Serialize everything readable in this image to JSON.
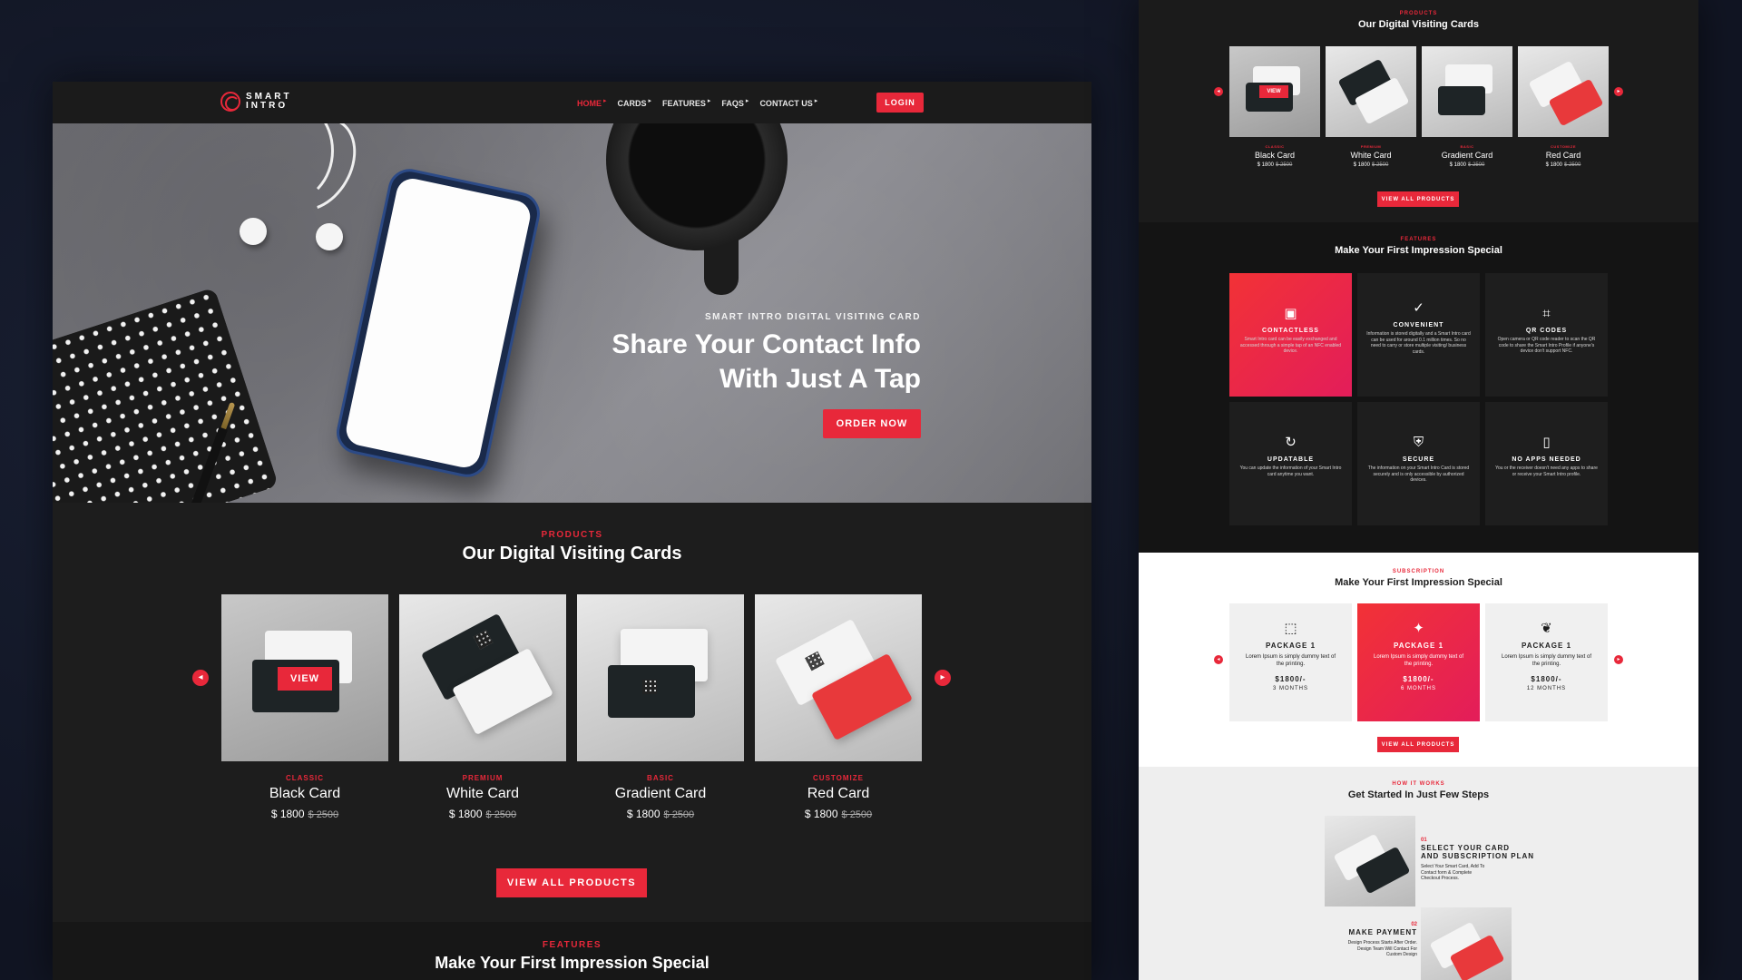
{
  "colors": {
    "accent": "#e8283a",
    "dark_bg": "#1d1d1d",
    "page_bg": "#151a2a"
  },
  "nav": {
    "logo_line1": "SMART",
    "logo_line2": "INTRO",
    "items": [
      "HOME",
      "CARDS",
      "FEATURES",
      "FAQS",
      "CONTACT US"
    ],
    "active": "HOME",
    "login": "LOGIN"
  },
  "hero": {
    "eyebrow": "SMART INTRO DIGITAL VISITING CARD",
    "headline_1": "Share Your Contact Info",
    "headline_2": "With Just A Tap",
    "cta": "ORDER NOW"
  },
  "products": {
    "label": "PRODUCTS",
    "title": "Our Digital Visiting Cards",
    "view_label": "VIEW",
    "prev_icon": "chevron-left-icon",
    "next_icon": "chevron-right-icon",
    "cards": [
      {
        "tag": "CLASSIC",
        "name": "Black Card",
        "price": "$ 1800",
        "old_price": "$ 2500"
      },
      {
        "tag": "PREMIUM",
        "name": "White Card",
        "price": "$ 1800",
        "old_price": "$ 2500"
      },
      {
        "tag": "BASIC",
        "name": "Gradient Card",
        "price": "$ 1800",
        "old_price": "$ 2500"
      },
      {
        "tag": "CUSTOMIZE",
        "name": "Red Card",
        "price": "$ 1800",
        "old_price": "$ 2500"
      }
    ],
    "view_all": "VIEW ALL PRODUCTS"
  },
  "features": {
    "label": "FEATURES",
    "title": "Make Your First Impression Special",
    "items": [
      {
        "icon": "wallet-icon",
        "glyph": "▣",
        "title": "CONTACTLESS",
        "desc": "Smart Intro card can be easily exchanged and accessed through a simple tap of an NFC enabled device."
      },
      {
        "icon": "check-circle-icon",
        "glyph": "✓",
        "title": "CONVENIENT",
        "desc": "Information is stored digitally and a Smart Intro card can be used for around 0.1 million times. So no need to carry or store multiple visiting/ business cards."
      },
      {
        "icon": "qr-code-icon",
        "glyph": "⌗",
        "title": "QR CODES",
        "desc": "Open camera or QR code reader to scan the QR code to share the Smart Intro Profile if anyone's device don't support NFC."
      },
      {
        "icon": "refresh-icon",
        "glyph": "↻",
        "title": "UPDATABLE",
        "desc": "You can update the information of your Smart Intro card anytime you want."
      },
      {
        "icon": "shield-icon",
        "glyph": "⛨",
        "title": "SECURE",
        "desc": "The information on your Smart Intro Card is stored securely and is only accessible by authorized devices."
      },
      {
        "icon": "mobile-icon",
        "glyph": "▯",
        "title": "NO APPS NEEDED",
        "desc": "You or the receiver doesn't need any apps to share or receive your Smart Intro profile."
      }
    ]
  },
  "subscription": {
    "label": "SUBSCRIPTION",
    "title": "Make Your First Impression Special",
    "packages": [
      {
        "icon": "frame-icon",
        "glyph": "⬚",
        "title": "PACKAGE 1",
        "desc": "Lorem Ipsum is simply dummy text of the printing.",
        "price": "$1800/-",
        "period": "3 MONTHS"
      },
      {
        "icon": "sparkle-icon",
        "glyph": "✦",
        "title": "PACKAGE 1",
        "desc": "Lorem Ipsum is simply dummy text of the printing.",
        "price": "$1800/-",
        "period": "6 MONTHS"
      },
      {
        "icon": "leaf-icon",
        "glyph": "❦",
        "title": "PACKAGE 1",
        "desc": "Lorem Ipsum is simply dummy text of the printing.",
        "price": "$1800/-",
        "period": "12 MONTHS"
      }
    ],
    "view_all": "VIEW ALL PRODUCTS"
  },
  "how": {
    "label": "HOW IT WORKS",
    "title": "Get Started In Just Few Steps",
    "steps": [
      {
        "num": "01",
        "title_1": "SELECT YOUR CARD",
        "title_2": "AND SUBSCRIPTION PLAN",
        "desc_1": "Select Your Smart Card, Add To",
        "desc_2": "Contact form & Complete",
        "desc_3": "Checkout Process."
      },
      {
        "num": "02",
        "title_1": "MAKE PAYMENT",
        "title_2": "",
        "desc_1": "Design Process Starts After Order.",
        "desc_2": "Design Team Will Contact For",
        "desc_3": "Custom Design"
      }
    ]
  }
}
